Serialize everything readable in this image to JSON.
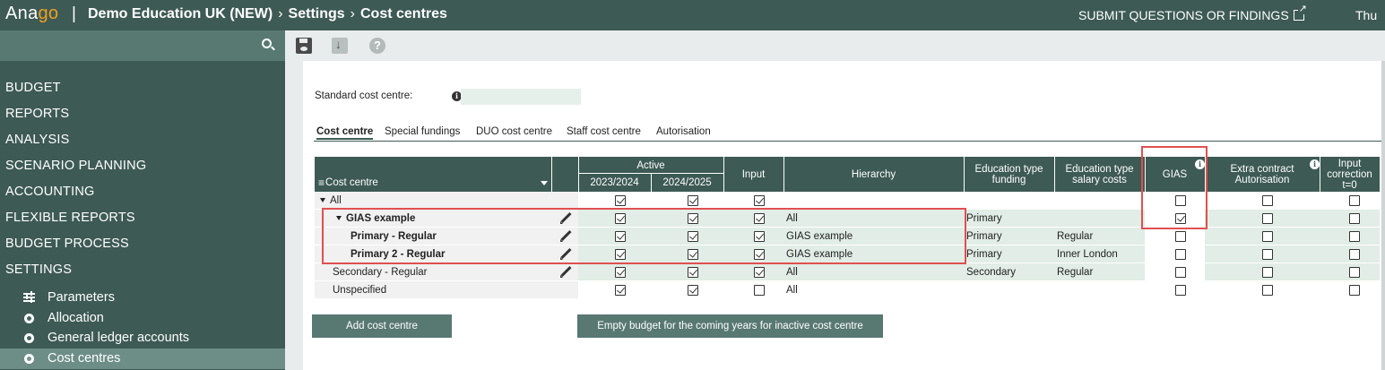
{
  "header": {
    "logo_a": "Ana",
    "logo_b": "go",
    "logo_sep": "|",
    "breadcrumb": [
      "Demo Education UK (NEW)",
      "Settings",
      "Cost centres"
    ],
    "breadcrumb_sep": "›",
    "submit_link": "SUBMIT QUESTIONS OR FINDINGS",
    "day": "Thu"
  },
  "sidebar": {
    "nav_items": [
      "BUDGET",
      "REPORTS",
      "ANALYSIS",
      "SCENARIO PLANNING",
      "ACCOUNTING",
      "FLEXIBLE REPORTS",
      "BUDGET PROCESS",
      "SETTINGS"
    ],
    "sub_items": [
      {
        "label": "Parameters",
        "icon": "sliders-icon"
      },
      {
        "label": "Allocation",
        "icon": "gear-icon"
      },
      {
        "label": "General ledger accounts",
        "icon": "gear-icon"
      },
      {
        "label": "Cost centres",
        "icon": "gear-icon",
        "active": true
      }
    ]
  },
  "toolbar": {
    "icons": [
      "save-icon",
      "export-icon",
      "help-icon"
    ],
    "help_glyph": "?"
  },
  "standard_cost_centre": {
    "label": "Standard cost centre:",
    "info": "i",
    "value": ""
  },
  "tabs": [
    "Cost centre",
    "Special fundings",
    "DUO cost centre",
    "Staff cost centre",
    "Autorisation"
  ],
  "table": {
    "headers": {
      "cost_centre": "Cost centre",
      "active": "Active",
      "year1": "2023/2024",
      "year2": "2024/2025",
      "input": "Input",
      "hierarchy": "Hierarchy",
      "edu_funding": "Education type funding",
      "edu_salary": "Education type salary costs",
      "gias": "GIAS",
      "extra_contract": "Extra contract Autorisation",
      "input_correction": "Input correction t=0"
    },
    "rows": [
      {
        "name": "All",
        "caret": true,
        "edit": false,
        "y1": true,
        "y2": true,
        "input": true,
        "hierarchy": "",
        "funding": "",
        "salary": "",
        "gias": false,
        "extra": false,
        "corr": false
      },
      {
        "name": "GIAS example",
        "caret": true,
        "edit": true,
        "y1": true,
        "y2": true,
        "input": true,
        "hierarchy": "All",
        "funding": "Primary",
        "salary": "",
        "gias": true,
        "extra": false,
        "corr": false
      },
      {
        "name": "Primary - Regular",
        "caret": false,
        "edit": true,
        "y1": true,
        "y2": true,
        "input": true,
        "hierarchy": "GIAS example",
        "funding": "Primary",
        "salary": "Regular",
        "gias": false,
        "extra": false,
        "corr": false
      },
      {
        "name": "Primary 2 - Regular",
        "caret": false,
        "edit": true,
        "y1": true,
        "y2": true,
        "input": true,
        "hierarchy": "GIAS example",
        "funding": "Primary",
        "salary": "Inner London",
        "gias": false,
        "extra": false,
        "corr": false
      },
      {
        "name": "Secondary - Regular",
        "caret": false,
        "edit": true,
        "y1": true,
        "y2": true,
        "input": true,
        "hierarchy": "All",
        "funding": "Secondary",
        "salary": "Regular",
        "gias": false,
        "extra": false,
        "corr": false
      },
      {
        "name": "Unspecified",
        "caret": false,
        "edit": false,
        "y1": true,
        "y2": true,
        "input": false,
        "hierarchy": "All",
        "funding": "",
        "salary": "",
        "gias": false,
        "extra": false,
        "corr": false
      }
    ]
  },
  "buttons": {
    "add": "Add cost centre",
    "empty_budget": "Empty budget for the coming years for inactive cost centre"
  }
}
